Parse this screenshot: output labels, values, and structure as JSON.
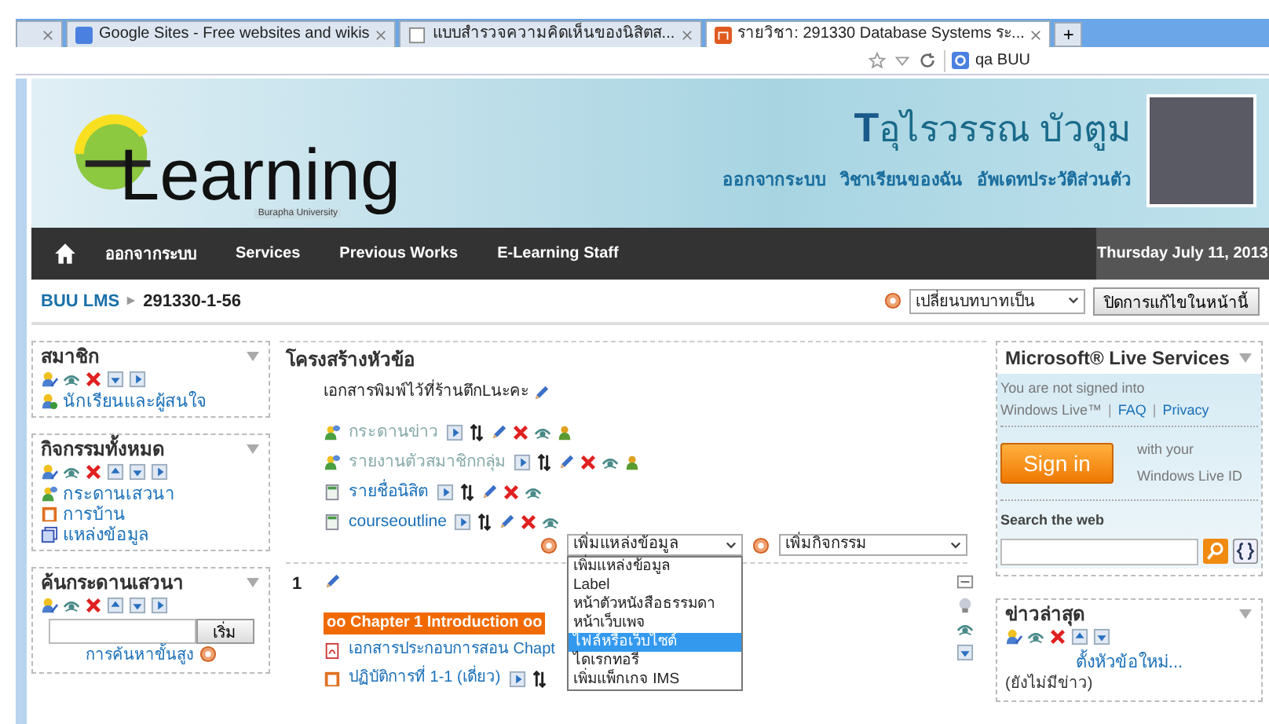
{
  "browser": {
    "tabs": [
      {
        "kind": "empty",
        "selected": false
      },
      {
        "title": "Google Sites - Free websites and wikis",
        "kind": "google",
        "selected": false
      },
      {
        "title": "แบบสำรวจความคิดเห็นของนิสิตส...",
        "kind": "blank",
        "selected": false
      },
      {
        "title": "รายวิชา: 291330 Database Systems ระ...",
        "kind": "course",
        "selected": true
      }
    ],
    "new_tab": "+",
    "search": {
      "value": "qa BUU"
    }
  },
  "header": {
    "logo": {
      "word": "Learning",
      "tagline": "Burapha University"
    },
    "user_name": "**T**อุไรวรรณ บัวตูม",
    "links": [
      "ออกจากระบบ",
      "วิชาเรียนของฉัน",
      "อัพเดทประวัติส่วนตัว"
    ]
  },
  "nav": {
    "items": [
      "ออกจากระบบ",
      "Services",
      "Previous Works",
      "E-Learning Staff"
    ],
    "date": "Thursday July 11, 2013"
  },
  "breadcrumb": {
    "items": [
      "BUU LMS",
      "291330-1-56"
    ],
    "role_select": "เปลี่ยนบทบาทเป็น",
    "edit_button": "ปิดการแก้ไขในหน้านี้"
  },
  "left_blocks": [
    {
      "title": "สมาชิก",
      "controls": [
        {
          "kind": "roles"
        },
        {
          "kind": "hide"
        },
        {
          "kind": "delete"
        },
        {
          "kind": "down"
        },
        {
          "kind": "right"
        }
      ],
      "items": [
        {
          "kind": "users",
          "label": "นักเรียนและผู้สนใจ"
        }
      ]
    },
    {
      "title": "กิจกรรมทั้งหมด",
      "controls": [
        {
          "kind": "roles"
        },
        {
          "kind": "hide"
        },
        {
          "kind": "delete"
        },
        {
          "kind": "up"
        },
        {
          "kind": "down"
        },
        {
          "kind": "right"
        }
      ],
      "items": [
        {
          "kind": "forum",
          "label": "กระดานเสวนา"
        },
        {
          "kind": "assign",
          "label": "การบ้าน"
        },
        {
          "kind": "resource",
          "label": "แหล่งข้อมูล"
        }
      ]
    },
    {
      "title": "ค้นกระดานเสวนา",
      "controls": [
        {
          "kind": "roles"
        },
        {
          "kind": "hide"
        },
        {
          "kind": "delete"
        },
        {
          "kind": "up"
        },
        {
          "kind": "down"
        },
        {
          "kind": "right"
        }
      ],
      "search": {
        "button": "เริ่ม",
        "link": "การค้นหาขั้นสูง"
      }
    }
  ],
  "center": {
    "title": "โครงสร้างหัวข้อ",
    "summary": "เอกสารพิมพ์ไว้ที่ร้านตึกLนะคะ",
    "activities": [
      {
        "kind": "forum",
        "name": "กระดานข่าว",
        "dimmed": true,
        "controls": [
          {
            "kind": "right"
          },
          {
            "kind": "move"
          },
          {
            "kind": "edit"
          },
          {
            "kind": "delete"
          },
          {
            "kind": "hide"
          },
          {
            "kind": "group"
          }
        ]
      },
      {
        "kind": "forum",
        "name": "รายงานตัวสมาชิกกลุ่ม",
        "dimmed": true,
        "controls": [
          {
            "kind": "right"
          },
          {
            "kind": "move"
          },
          {
            "kind": "edit"
          },
          {
            "kind": "delete"
          },
          {
            "kind": "hide"
          },
          {
            "kind": "group"
          }
        ]
      },
      {
        "kind": "page",
        "name": "รายชื่อนิสิต",
        "dimmed": false,
        "controls": [
          {
            "kind": "right"
          },
          {
            "kind": "move"
          },
          {
            "kind": "edit"
          },
          {
            "kind": "delete"
          },
          {
            "kind": "hide"
          }
        ]
      },
      {
        "kind": "page",
        "name": "courseoutline",
        "dimmed": false,
        "controls": [
          {
            "kind": "right"
          },
          {
            "kind": "move"
          },
          {
            "kind": "edit"
          },
          {
            "kind": "delete"
          },
          {
            "kind": "hide"
          }
        ]
      }
    ],
    "add_resource": "เพิ่มแหล่งข้อมูล",
    "add_activity": "เพิ่มกิจกรรม",
    "resource_options": [
      {
        "label": "เพิ่มแหล่งข้อมูล",
        "selected": false
      },
      {
        "label": "Label",
        "selected": false
      },
      {
        "label": "หน้าตัวหนังสือธรรมดา",
        "selected": false
      },
      {
        "label": "หน้าเว็บเพจ",
        "selected": false
      },
      {
        "label": "ไฟล์หรือเว็บไซต์",
        "selected": true
      },
      {
        "label": "ไดเรกทอรี",
        "selected": false
      },
      {
        "label": "เพิ่มแพ็กเกจ IMS",
        "selected": false
      }
    ],
    "section": {
      "number": "1",
      "label": "oo Chapter 1 Introduction oo",
      "items": [
        {
          "kind": "pdf",
          "name": "เอกสารประกอบการสอน Chapt"
        },
        {
          "kind": "assign",
          "name": "ปฏิบัติการที่ 1-1 (เดี่ยว)",
          "controls": [
            {
              "kind": "right"
            },
            {
              "kind": "move"
            }
          ]
        }
      ],
      "side_controls": [
        {
          "kind": "minus"
        },
        {
          "kind": "bulb"
        },
        {
          "kind": "hide"
        },
        {
          "kind": "down"
        }
      ]
    }
  },
  "right": {
    "live": {
      "title": "Microsoft® Live Services",
      "status": "You are not signed into",
      "line": [
        {
          "kind": "text",
          "text": "Windows Live™"
        },
        {
          "kind": "separator",
          "text": "|"
        },
        {
          "kind": "link",
          "text": "FAQ"
        },
        {
          "kind": "separator",
          "text": "|"
        },
        {
          "kind": "link",
          "text": "Privacy"
        }
      ],
      "sign_in": "Sign in",
      "with": "with your",
      "id": "Windows Live ID",
      "search_label": "Search the web"
    },
    "news": {
      "title": "ข่าวล่าสุด",
      "controls": [
        {
          "kind": "roles"
        },
        {
          "kind": "hide"
        },
        {
          "kind": "delete"
        },
        {
          "kind": "up"
        },
        {
          "kind": "down"
        }
      ],
      "add": "ตั้งหัวข้อใหม่...",
      "empty": "(ยังไม่มีข่าว)"
    }
  }
}
